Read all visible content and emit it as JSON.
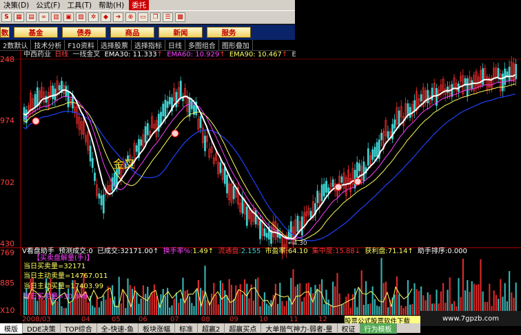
{
  "menu": {
    "items": [
      "决策(D)",
      "公式(F)",
      "工具(T)",
      "帮助(H)"
    ],
    "close_label": "委托"
  },
  "toolbar": {
    "icon_names": [
      "s-logo-icon",
      "grid-icon",
      "chart-icon",
      "binoculars-icon",
      "tile-icon",
      "save-icon",
      "chart-type-icon",
      "gear-icon",
      "diamond-icon",
      "arrow-icon",
      "zoom-icon",
      "ruler-icon",
      "window-icon",
      "list-icon",
      "panel-icon"
    ]
  },
  "nav": {
    "items": [
      "数",
      "基金",
      "债券",
      "商品",
      "新闻",
      "服务"
    ]
  },
  "funcbar": {
    "items": [
      "2数默认",
      "技术分析",
      "F10资料",
      "选择股票",
      "选择指标",
      "日线",
      "多图组合",
      "图形叠加"
    ]
  },
  "chart_header": {
    "stock": "中西药业",
    "period": "日线",
    "indicator": "一线金叉",
    "ema30": "EMA30: 11.333",
    "ema60": "EMA60: 10.929",
    "ema90": "EMA90: 10.467",
    "ema_arrow": "↑",
    "more": "E"
  },
  "price_axis": {
    "labels": [
      "248",
      "974",
      "702",
      "430"
    ]
  },
  "low_label": "←4.30",
  "gold_cross": "金叉",
  "sub_header": {
    "title": "V看盘助手",
    "items": [
      {
        "label": "预测成交:",
        "value": "0"
      },
      {
        "label": "已成交:",
        "value": "32171.00↑"
      },
      {
        "label": "换手率%:",
        "value": "1.49↑"
      },
      {
        "label": "流通盘:",
        "value": "2.155"
      },
      {
        "label": "市盈率:",
        "value": "64.10"
      },
      {
        "label": "集中度:",
        "value": "15.88↓"
      },
      {
        "label": "获利盘:",
        "value": "71.14↑"
      },
      {
        "label": "助手排序:",
        "value": "0.000"
      }
    ]
  },
  "volume_axis": {
    "labels": [
      "769",
      "885",
      "X10"
    ]
  },
  "volume_legend": {
    "title": "【买卖盘解量(手)】",
    "lines": [
      "当日买卖量=32171",
      "当日主动卖量=14767.011",
      "当日主动买量=17403.99",
      "当日买卖量=30.848"
    ]
  },
  "timeline": {
    "labels": [
      "2008/03",
      "04",
      "05",
      "06",
      "07",
      "08",
      "09",
      "10",
      "11",
      "12"
    ]
  },
  "ad_text": "股票公式股票软件下载",
  "statusbar": {
    "items": [
      "模版",
      "DDE决策",
      "TOP综合",
      "全-快速-鱼",
      "板块涨幅",
      "标准",
      "超赢2",
      "超赢买点",
      "大单揩气神力-弱者-量",
      "权证",
      "行为模板"
    ]
  },
  "watermark": "www.7gpzb.com",
  "colors": {
    "up": "#ff3030",
    "down": "#40d0d0",
    "ema30": "#ffffff",
    "ema60": "#ff40ff",
    "ema90": "#ffff60",
    "ema_long": "#2040ff"
  }
}
